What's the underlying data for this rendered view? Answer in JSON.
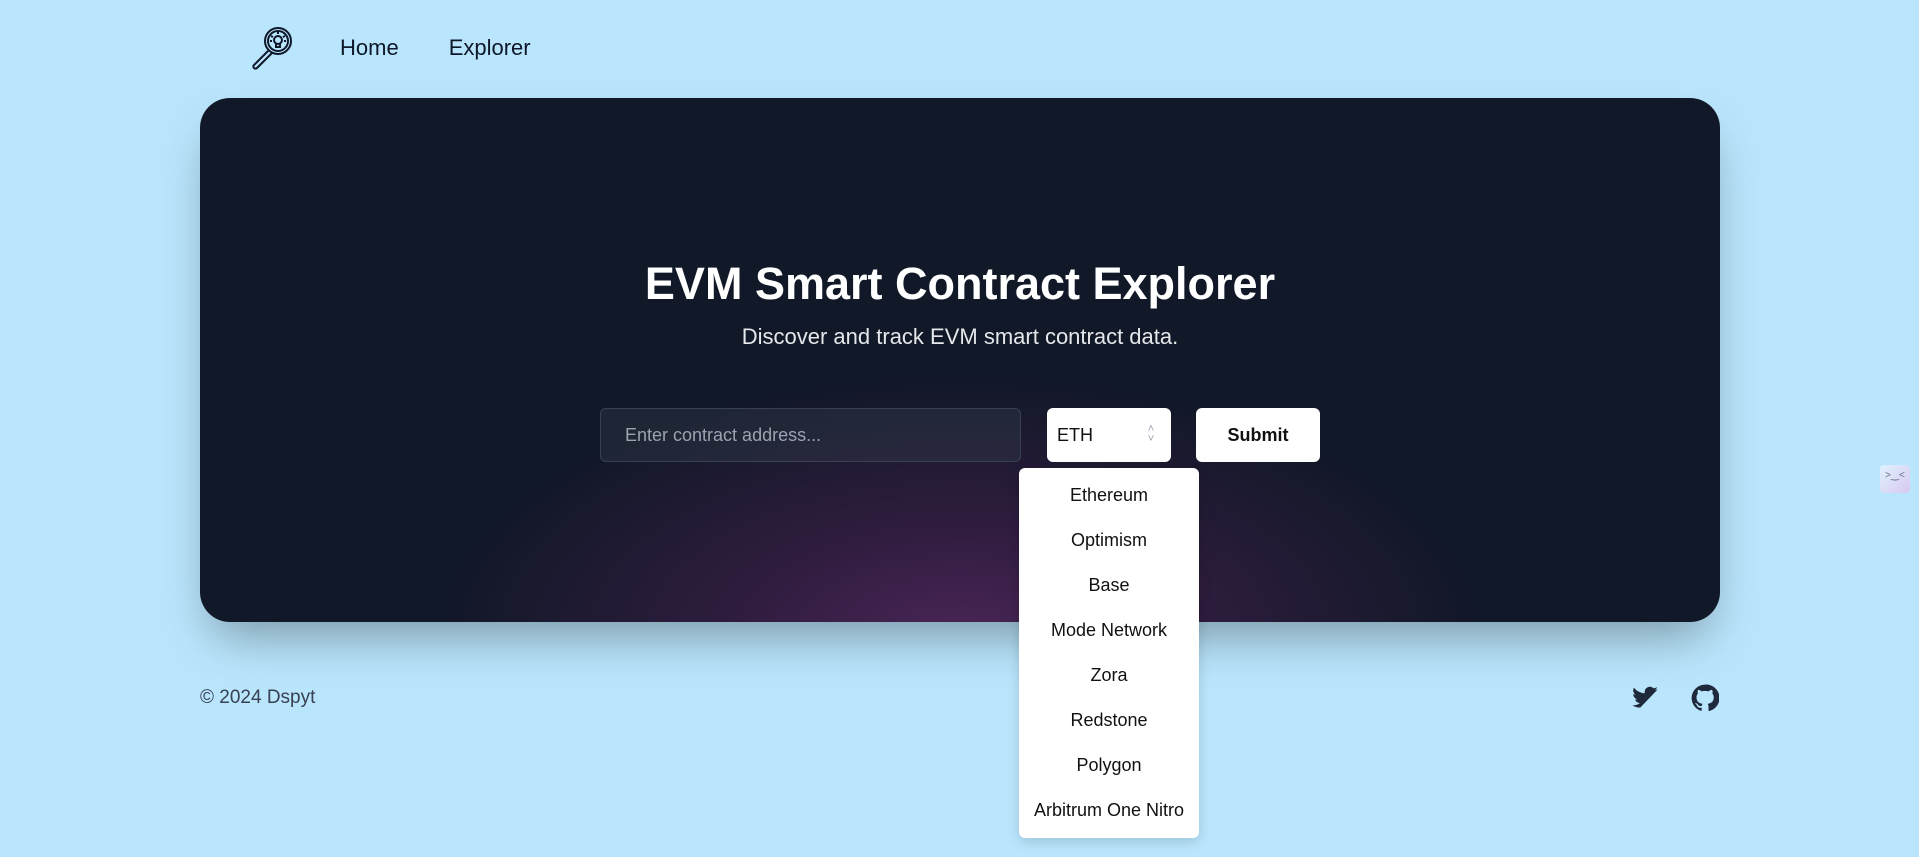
{
  "nav": {
    "home": "Home",
    "explorer": "Explorer"
  },
  "hero": {
    "title": "EVM Smart Contract Explorer",
    "subtitle": "Discover and track EVM smart contract data."
  },
  "form": {
    "address_placeholder": "Enter contract address...",
    "address_value": "",
    "network_selected": "ETH",
    "submit_label": "Submit"
  },
  "dropdown": {
    "options": [
      "Ethereum",
      "Optimism",
      "Base",
      "Mode Network",
      "Zora",
      "Redstone",
      "Polygon",
      "Arbitrum One Nitro"
    ]
  },
  "footer": {
    "copyright": "© 2024 Dspyt"
  },
  "widget": {
    "label": ">‿<"
  }
}
